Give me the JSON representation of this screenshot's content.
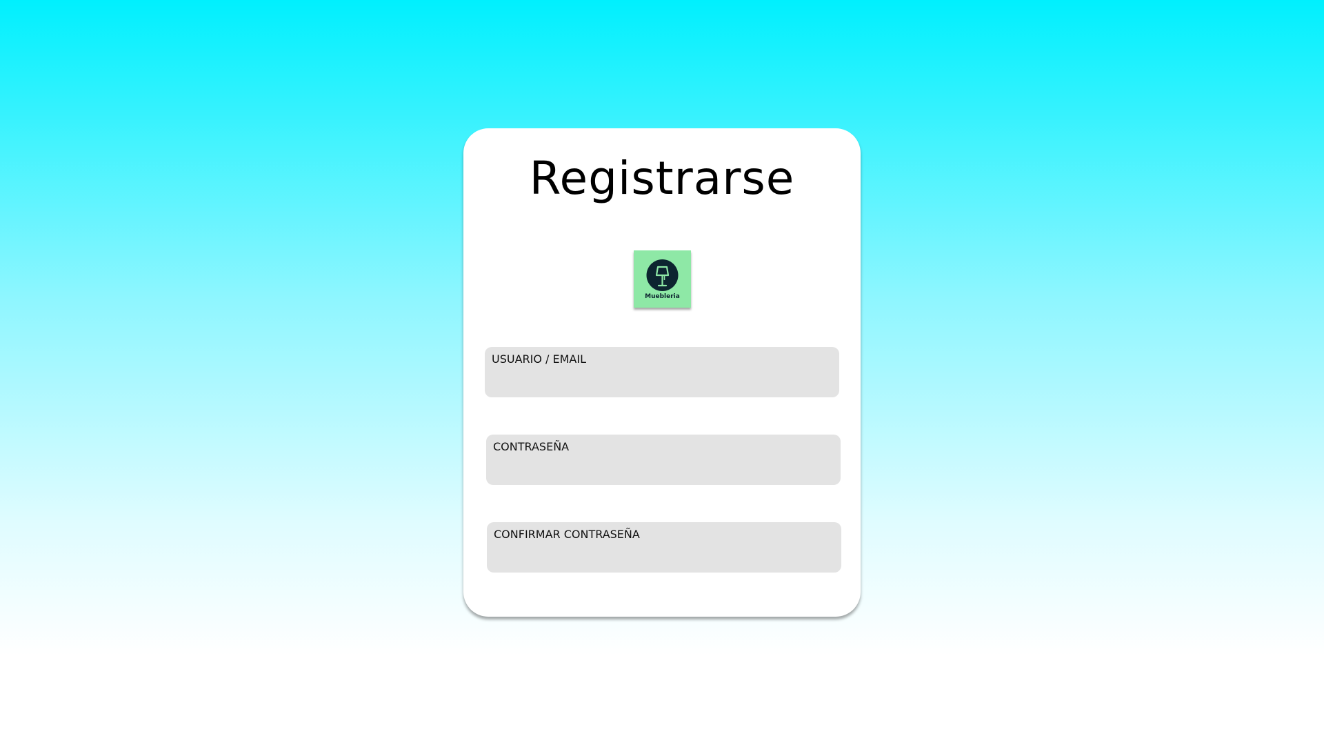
{
  "form": {
    "title": "Registrarse",
    "logo": {
      "text": "Muebleria",
      "icon": "lamp-icon",
      "background_color": "#8ee8a6",
      "circle_color": "#0d2430",
      "accent_color": "#8ee8a6"
    },
    "fields": [
      {
        "label": "USUARIO / EMAIL",
        "value": "",
        "type": "text"
      },
      {
        "label": "CONTRASEÑA",
        "value": "",
        "type": "password"
      },
      {
        "label": "CONFIRMAR CONTRASEÑA",
        "value": "",
        "type": "password"
      }
    ]
  },
  "colors": {
    "background_top": "#00f0fe",
    "background_bottom": "#ffffff",
    "card": "#ffffff",
    "field": "#e3e3e3"
  }
}
